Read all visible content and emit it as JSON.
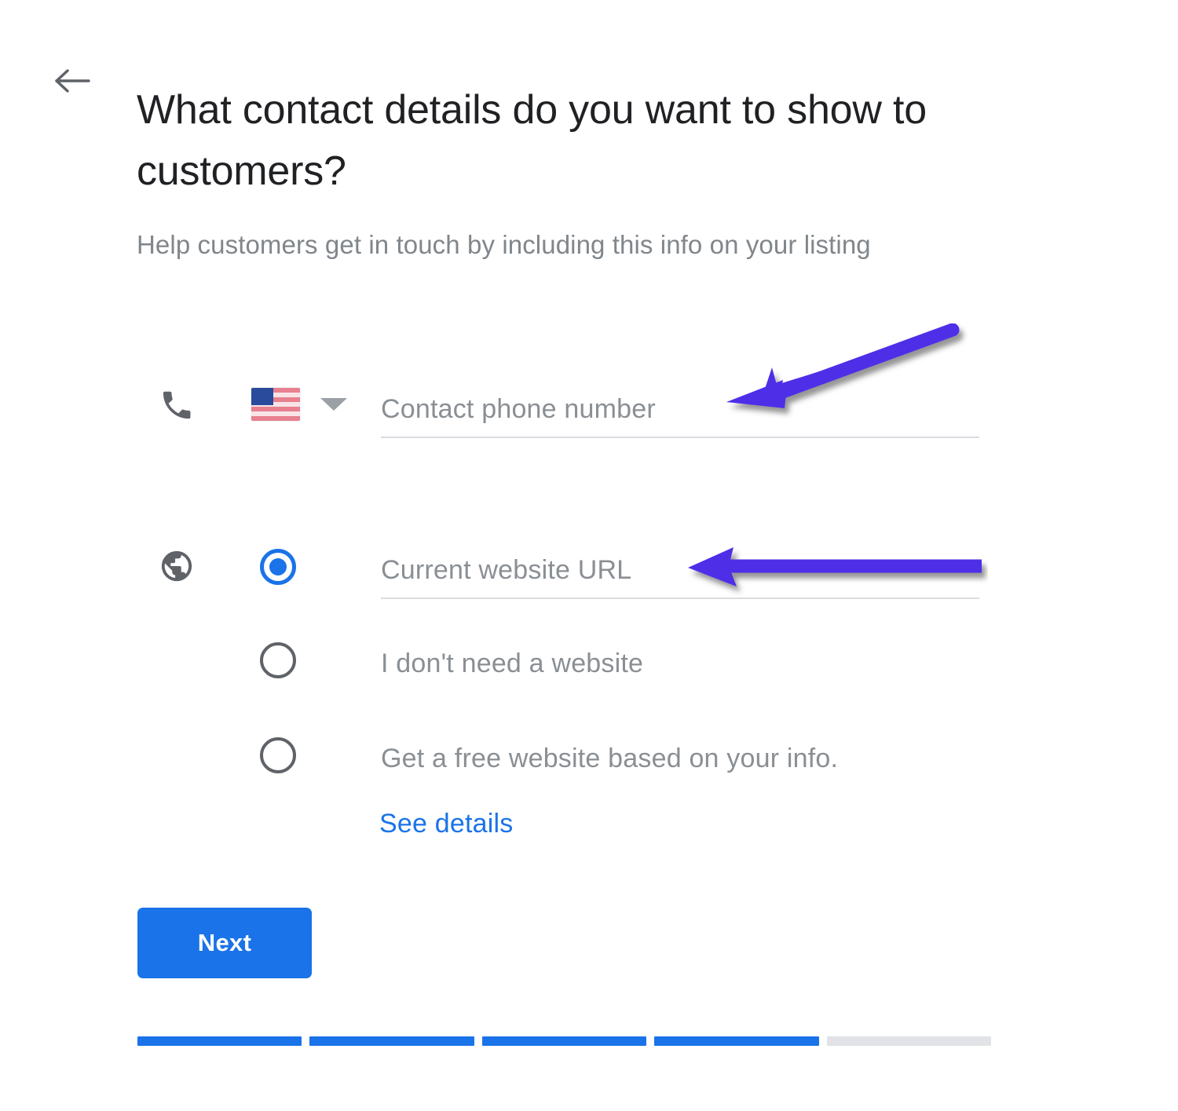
{
  "header": {
    "back_icon": "arrow-left-icon",
    "title": "What contact details do you want to show to customers?",
    "subtitle": "Help customers get in touch by including this info on your listing"
  },
  "phone": {
    "icon": "phone-icon",
    "country_flag": "us-flag-icon",
    "country_dropdown_icon": "chevron-down-icon",
    "placeholder": "Contact phone number",
    "value": ""
  },
  "website": {
    "icon": "globe-icon",
    "options": [
      {
        "label": "Current website URL",
        "is_field": true,
        "selected": true
      },
      {
        "label": "I don't need a website",
        "is_field": false,
        "selected": false
      },
      {
        "label": "Get a free website based on your info.",
        "is_field": false,
        "selected": false
      }
    ],
    "link_label": "See details"
  },
  "actions": {
    "next_label": "Next"
  },
  "progress": {
    "total_steps": 5,
    "completed_steps": 4,
    "segments": [
      true,
      true,
      true,
      true,
      false
    ]
  },
  "annotations": [
    {
      "name": "phone-field-arrow",
      "color": "#4f2fe8",
      "direction": "down-left"
    },
    {
      "name": "website-field-arrow",
      "color": "#4f2fe8",
      "direction": "left"
    }
  ],
  "colors": {
    "accent_blue": "#1a73e8",
    "text_primary": "#202124",
    "text_secondary": "#80868b",
    "field_underline": "#dadce0",
    "progress_empty": "#e1e3e6",
    "annotation_purple": "#4f2fe8"
  }
}
